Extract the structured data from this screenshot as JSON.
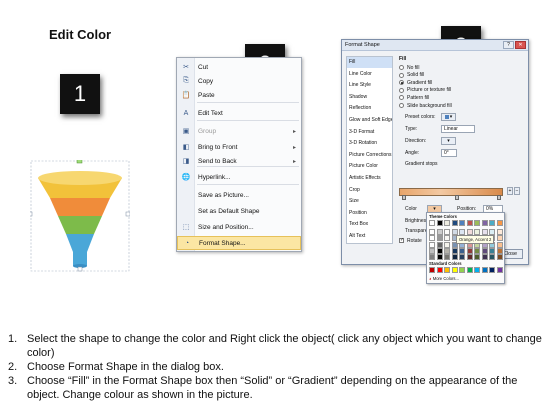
{
  "title": "Edit Color",
  "steps": [
    "1",
    "2",
    "3"
  ],
  "funnel": {
    "colors": [
      "#f2c23a",
      "#f08c3a",
      "#7dbb4a",
      "#4aa7d8"
    ]
  },
  "context_menu": {
    "items": [
      {
        "label": "Cut",
        "icon": "scissors-icon",
        "glyph": "✂",
        "disabled": false,
        "submenu": false
      },
      {
        "label": "Copy",
        "icon": "copy-icon",
        "glyph": "⎘",
        "disabled": false,
        "submenu": false
      },
      {
        "label": "Paste",
        "icon": "paste-icon",
        "glyph": "📋",
        "disabled": false,
        "submenu": false
      },
      {
        "label": "Edit Text",
        "icon": "edit-text-icon",
        "glyph": "A",
        "disabled": false,
        "submenu": false
      },
      {
        "label": "Group",
        "icon": "group-icon",
        "glyph": "▣",
        "disabled": true,
        "submenu": true
      },
      {
        "label": "Bring to Front",
        "icon": "bring-to-front-icon",
        "glyph": "◧",
        "disabled": false,
        "submenu": true
      },
      {
        "label": "Send to Back",
        "icon": "send-to-back-icon",
        "glyph": "◨",
        "disabled": false,
        "submenu": true
      },
      {
        "label": "Hyperlink...",
        "icon": "hyperlink-icon",
        "glyph": "🌐",
        "disabled": false,
        "submenu": false
      },
      {
        "label": "Save as Picture...",
        "icon": "",
        "glyph": "",
        "disabled": false,
        "submenu": false
      },
      {
        "label": "Set as Default Shape",
        "icon": "",
        "glyph": "",
        "disabled": false,
        "submenu": false
      },
      {
        "label": "Size and Position...",
        "icon": "size-position-icon",
        "glyph": "⬚",
        "disabled": false,
        "submenu": false
      },
      {
        "label": "Format Shape...",
        "icon": "format-shape-icon",
        "glyph": "◔",
        "disabled": false,
        "submenu": false,
        "highlighted": true
      }
    ]
  },
  "dialog": {
    "title": "Format Shape",
    "categories": [
      "Fill",
      "Line Color",
      "Line Style",
      "Shadow",
      "Reflection",
      "Glow and Soft Edges",
      "3-D Format",
      "3-D Rotation",
      "Picture Corrections",
      "Picture Color",
      "Artistic Effects",
      "Crop",
      "Size",
      "Position",
      "Text Box",
      "Alt Text"
    ],
    "selected_category": "Fill",
    "fill_heading": "Fill",
    "fill_options": [
      "No fill",
      "Solid fill",
      "Gradient fill",
      "Picture or texture fill",
      "Pattern fill",
      "Slide background fill"
    ],
    "selected_fill": "Gradient fill",
    "preset_colors_label": "Preset colors:",
    "type_label": "Type:",
    "type_value": "Linear",
    "direction_label": "Direction:",
    "angle_label": "Angle:",
    "angle_value": "0°",
    "gradient_stops_label": "Gradient stops",
    "color_label": "Color",
    "position_label": "Position:",
    "position_value": "0%",
    "brightness_label": "Brightness",
    "transparency_label": "Transpare",
    "rotate_label": "Rotate",
    "close_label": "Close"
  },
  "palette": {
    "theme_label": "Theme Colors",
    "standard_label": "Standard Colors",
    "more_label": "More Colors...",
    "tooltip": "Orange, Accent 2",
    "theme_top": [
      "#ffffff",
      "#000000",
      "#eeece1",
      "#1f497d",
      "#4f81bd",
      "#c0504d",
      "#9bbb59",
      "#8064a2",
      "#4bacc6",
      "#f79646"
    ],
    "standard": [
      "#c00000",
      "#ff0000",
      "#ffc000",
      "#ffff00",
      "#92d050",
      "#00b050",
      "#00b0f0",
      "#0070c0",
      "#002060",
      "#7030a0"
    ]
  },
  "instructions": [
    {
      "num": "1.",
      "text": "Select the shape to change the color and Right click the object( click any object which you want to change color)"
    },
    {
      "num": "2.",
      "text": "Choose Format Shape in the dialog box."
    },
    {
      "num": "3.",
      "text": "Choose “Fill” in the Format Shape box then “Solid” or “Gradient” depending on the appearance of the object. Change colour as shown in the picture."
    }
  ]
}
